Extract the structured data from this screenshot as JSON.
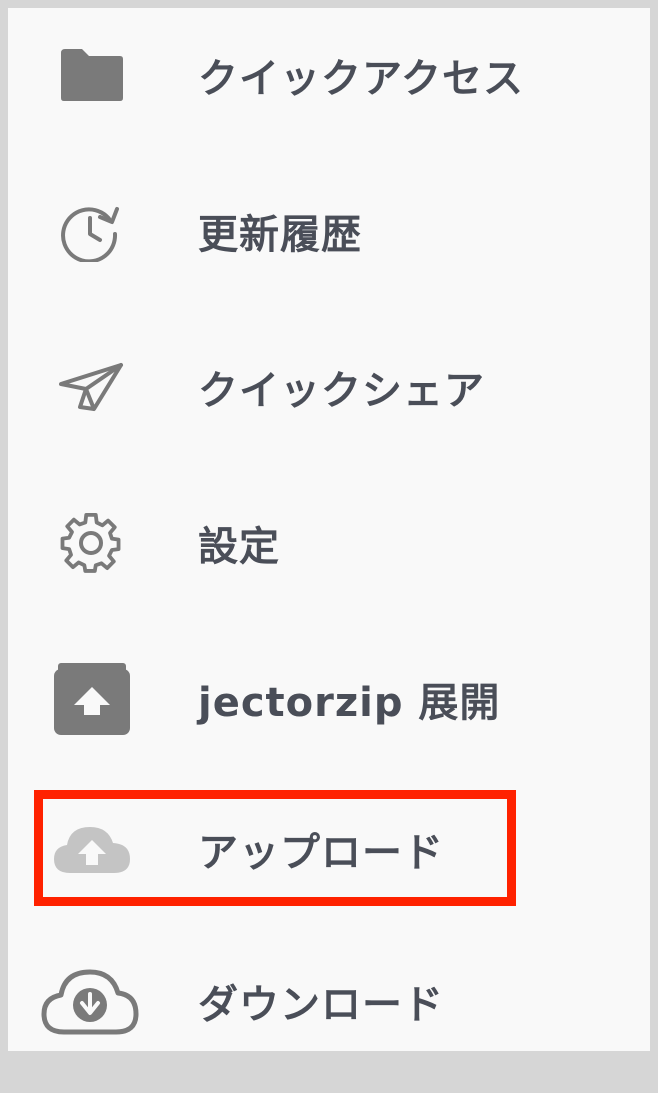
{
  "menu": {
    "items": [
      {
        "label": "クイックアクセス",
        "icon": "folder-icon"
      },
      {
        "label": "更新履歴",
        "icon": "history-icon"
      },
      {
        "label": "クイックシェア",
        "icon": "paper-plane-icon"
      },
      {
        "label": "設定",
        "icon": "gear-icon"
      },
      {
        "label": "jectorzip 展開",
        "icon": "archive-extract-icon"
      },
      {
        "label": "アップロード",
        "icon": "cloud-upload-icon"
      },
      {
        "label": "ダウンロード",
        "icon": "cloud-download-icon"
      }
    ]
  },
  "highlight": {
    "target": "アップロード",
    "color": "#ff2200"
  },
  "colors": {
    "background": "#f9f9f9",
    "frame": "#d6d6d6",
    "text": "#4a4e58",
    "icon": "#7a7a7a",
    "icon_disabled": "#c4c4c4"
  }
}
